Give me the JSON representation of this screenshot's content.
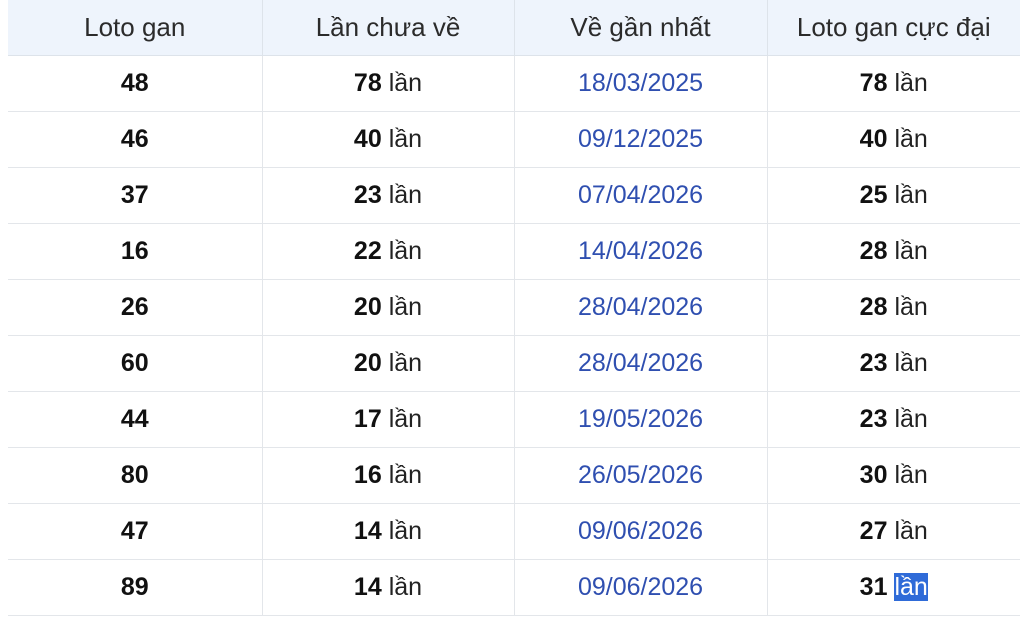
{
  "table": {
    "headers": [
      "Loto gan",
      "Lần chưa về",
      "Về gần nhất",
      "Loto gan cực đại"
    ],
    "rows": [
      {
        "loto": "48",
        "chua_ve": "78",
        "gan_nhat": "18/03/2025",
        "cuc_dai": "78"
      },
      {
        "loto": "46",
        "chua_ve": "40",
        "gan_nhat": "09/12/2025",
        "cuc_dai": "40"
      },
      {
        "loto": "37",
        "chua_ve": "23",
        "gan_nhat": "07/04/2026",
        "cuc_dai": "25"
      },
      {
        "loto": "16",
        "chua_ve": "22",
        "gan_nhat": "14/04/2026",
        "cuc_dai": "28"
      },
      {
        "loto": "26",
        "chua_ve": "20",
        "gan_nhat": "28/04/2026",
        "cuc_dai": "28"
      },
      {
        "loto": "60",
        "chua_ve": "20",
        "gan_nhat": "28/04/2026",
        "cuc_dai": "23"
      },
      {
        "loto": "44",
        "chua_ve": "17",
        "gan_nhat": "19/05/2026",
        "cuc_dai": "23"
      },
      {
        "loto": "80",
        "chua_ve": "16",
        "gan_nhat": "26/05/2026",
        "cuc_dai": "30"
      },
      {
        "loto": "47",
        "chua_ve": "14",
        "gan_nhat": "09/06/2026",
        "cuc_dai": "27"
      },
      {
        "loto": "89",
        "chua_ve": "14",
        "gan_nhat": "09/06/2026",
        "cuc_dai": "31"
      }
    ],
    "unit": "lần",
    "selected_text": "lần"
  },
  "colors": {
    "header_bg": "#eef4fc",
    "date_text": "#2f4fb0",
    "selection": "#2f6bd8"
  }
}
